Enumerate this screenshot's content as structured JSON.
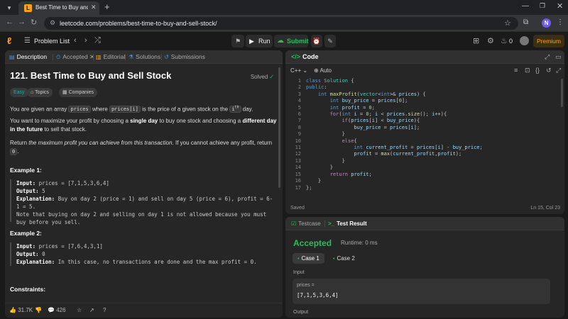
{
  "browser": {
    "tab_title": "Best Time to Buy and Sell Stock",
    "url": "leetcode.com/problems/best-time-to-buy-and-sell-stock/",
    "profile_initial": "N"
  },
  "header": {
    "problem_list": "Problem List",
    "run": "Run",
    "submit": "Submit",
    "streak": "0",
    "premium": "Premium"
  },
  "left_tabs": {
    "description": "Description",
    "accepted": "Accepted",
    "editorial": "Editorial",
    "solutions": "Solutions",
    "submissions": "Submissions"
  },
  "problem": {
    "title": "121. Best Time to Buy and Sell Stock",
    "status": "Solved",
    "tags": {
      "difficulty": "Easy",
      "topics": "Topics",
      "companies": "Companies"
    },
    "p1_a": "You are given an array ",
    "p1_code1": "prices",
    "p1_b": " where ",
    "p1_code2": "prices[i]",
    "p1_c": " is the price of a given stock on the ",
    "p1_code3": "i",
    "p1_sup": "th",
    "p1_d": " day.",
    "p2_a": "You want to maximize your profit by choosing a ",
    "p2_b1": "single day",
    "p2_b": " to buy one stock and choosing a ",
    "p2_b2": "different day in the future",
    "p2_c": " to sell that stock.",
    "p3_a": "Return ",
    "p3_em": "the maximum profit you can achieve from this transaction",
    "p3_b": ". If you cannot achieve any profit, return ",
    "p3_code": "0",
    "p3_c": ".",
    "ex1_title": "Example 1:",
    "ex1_input_label": "Input:",
    "ex1_input": "prices = [7,1,5,3,6,4]",
    "ex1_output_label": "Output:",
    "ex1_output": "5",
    "ex1_expl_label": "Explanation:",
    "ex1_expl": "Buy on day 2 (price = 1) and sell on day 5 (price = 6), profit = 6-1 = 5.",
    "ex1_note": "Note that buying on day 2 and selling on day 1 is not allowed because you must buy before you sell.",
    "ex2_title": "Example 2:",
    "ex2_input_label": "Input:",
    "ex2_input": "prices = [7,6,4,3,1]",
    "ex2_output_label": "Output:",
    "ex2_output": "0",
    "ex2_expl_label": "Explanation:",
    "ex2_expl": "In this case, no transactions are done and the max profit = 0.",
    "constraints_title": "Constraints:"
  },
  "footer": {
    "likes": "31.7K",
    "comments": "426"
  },
  "code_panel": {
    "title": "Code",
    "language": "C++",
    "mode": "Auto",
    "saved": "Saved",
    "cursor": "Ln 15, Col 23"
  },
  "result_panel": {
    "testcase_tab": "Testcase",
    "result_tab": "Test Result",
    "status": "Accepted",
    "runtime": "Runtime: 0 ms",
    "case1": "Case 1",
    "case2": "Case 2",
    "input_label": "Input",
    "var_name": "prices =",
    "var_value": "[7,1,5,3,6,4]",
    "output_label": "Output"
  }
}
